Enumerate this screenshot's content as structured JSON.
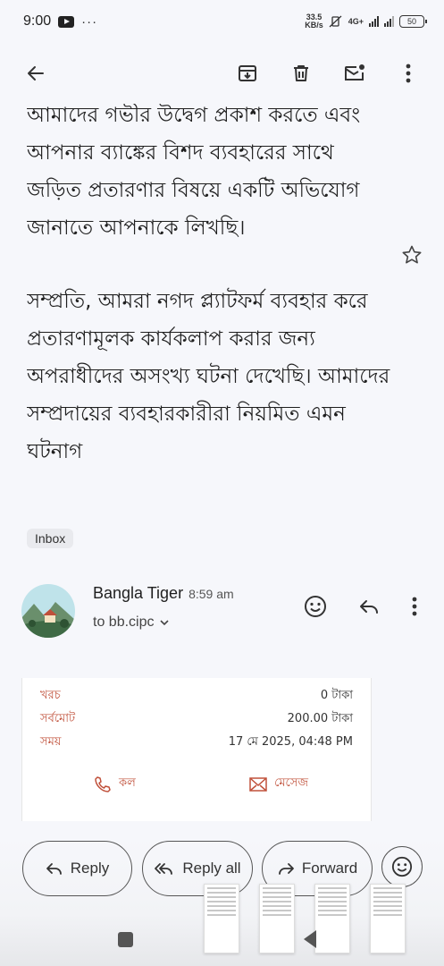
{
  "status_bar": {
    "time": "9:00",
    "more": "···",
    "net_speed_value": "33.5",
    "net_speed_unit": "KB/s",
    "network_type": "4G+",
    "battery": "50"
  },
  "toolbar": {
    "back_icon": "arrow-left",
    "archive_icon": "archive-down",
    "delete_icon": "trash",
    "mark_unread_icon": "mail-dot",
    "more_icon": "dots-vertical"
  },
  "email": {
    "paragraph_1": "আমাদের গভীর উদ্বেগ প্রকাশ করতে এবং আপনার ব্যাঙ্কের বিশদ ব্যবহারের সাথে জড়িত প্রতারণার বিষয়ে একটি অভিযোগ জানাতে আপনাকে লিখছি।",
    "paragraph_2": "সম্প্রতি, আমরা নগদ প্ল্যাটফর্ম ব্যবহার করে প্রতারণামূলক কার্যকলাপ করার জন্য অপরাধীদের অসংখ্য ঘটনা দেখেছি। আমাদের সম্প্রদায়ের ব্যবহারকারীরা নিয়মিত এমন ঘটনাগ",
    "label": "Inbox"
  },
  "message": {
    "sender_name": "Bangla Tiger",
    "time": "8:59 am",
    "recipient": "to bb.cipc"
  },
  "receipt": {
    "rows": [
      {
        "label": "খরচ",
        "value": "0 টাকা"
      },
      {
        "label": "সর্বমোট",
        "value": "200.00 টাকা"
      },
      {
        "label": "সময়",
        "value": "17 মে 2025, 04:48 PM"
      }
    ],
    "call_label": "কল",
    "message_label": "মেসেজ"
  },
  "actions": {
    "reply": "Reply",
    "reply_all": "Reply all",
    "forward": "Forward"
  },
  "colors": {
    "accent_red": "#c0503a",
    "background": "#f6f7fb"
  }
}
